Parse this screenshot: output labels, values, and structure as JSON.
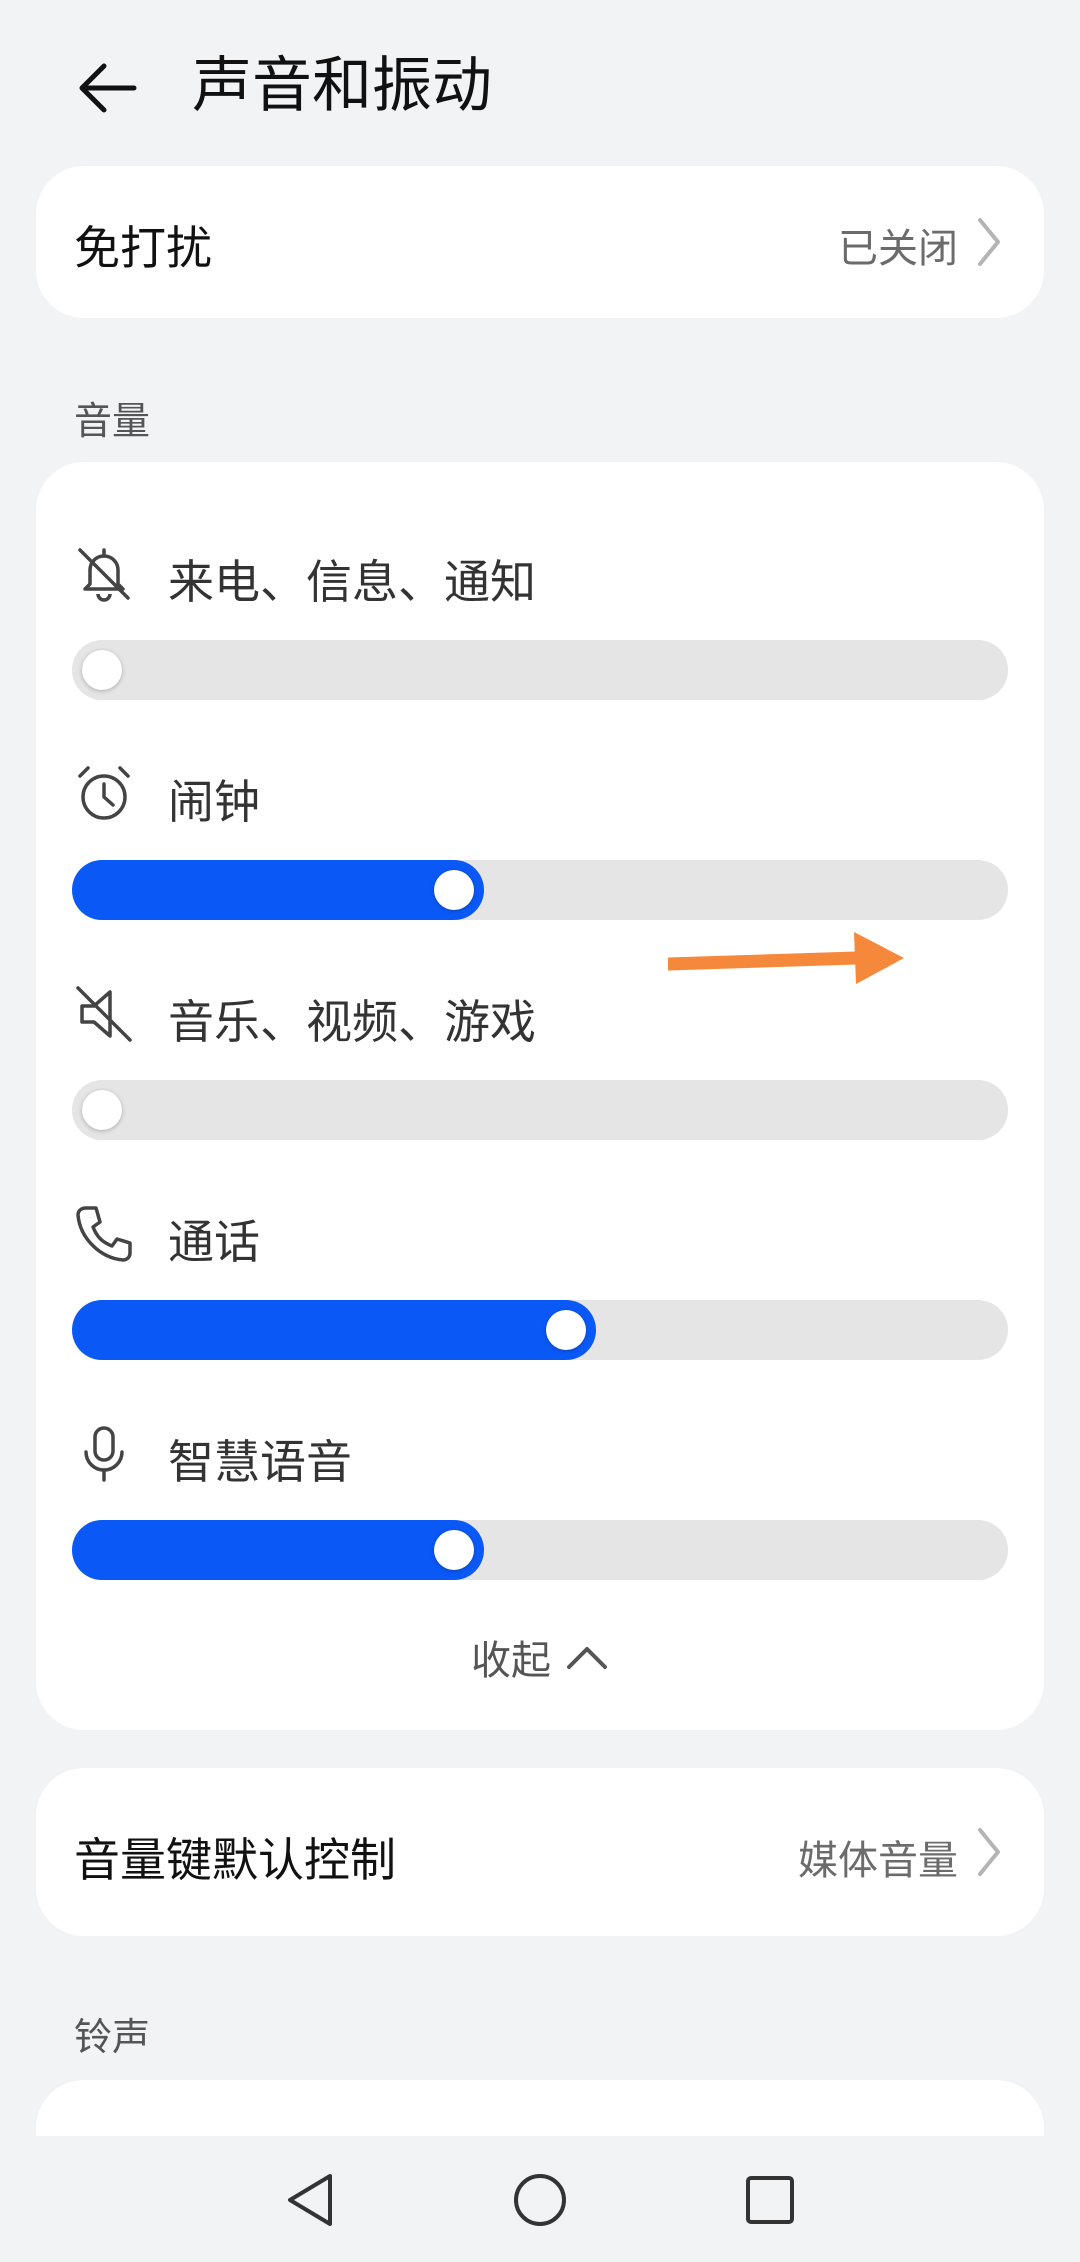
{
  "header": {
    "title": "声音和振动",
    "back_icon": "arrow-left-icon"
  },
  "dnd": {
    "title": "免打扰",
    "value": "已关闭"
  },
  "volume": {
    "section_label": "音量",
    "items": [
      {
        "label": "来电、信息、通知",
        "icon": "bell-muted-icon",
        "level": 0.0
      },
      {
        "label": "闹钟",
        "icon": "alarm-clock-icon",
        "level": 0.44
      },
      {
        "label": "音乐、视频、游戏",
        "icon": "speaker-muted-icon",
        "level": 0.0
      },
      {
        "label": "通话",
        "icon": "phone-icon",
        "level": 0.56
      },
      {
        "label": "智慧语音",
        "icon": "microphone-icon",
        "level": 0.44
      }
    ],
    "collapse_label": "收起"
  },
  "volume_key": {
    "title": "音量键默认控制",
    "value": "媒体音量"
  },
  "ringtone": {
    "section_label": "铃声"
  },
  "colors": {
    "accent": "#0a59f7",
    "track": "#e5e5e5",
    "annotation": "#f5883a",
    "background": "#f1f3f5"
  },
  "navbar": {
    "back_icon": "triangle-back-icon",
    "home_icon": "circle-home-icon",
    "recents_icon": "square-recents-icon"
  }
}
